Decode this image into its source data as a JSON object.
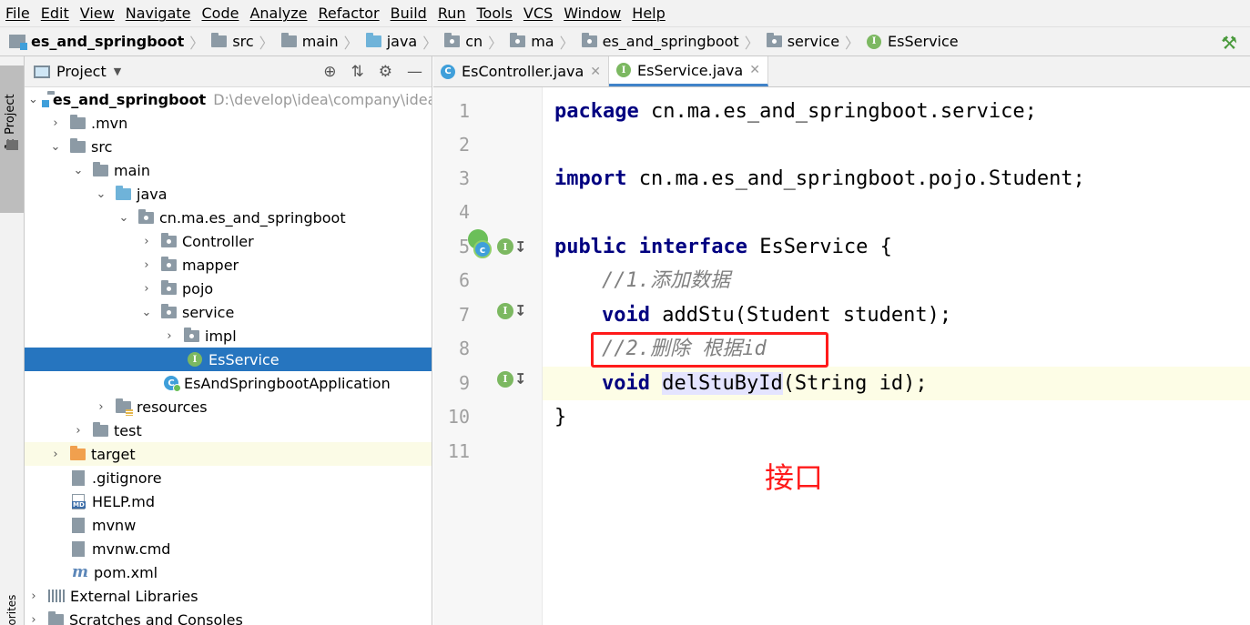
{
  "menu": [
    "File",
    "Edit",
    "View",
    "Navigate",
    "Code",
    "Analyze",
    "Refactor",
    "Build",
    "Run",
    "Tools",
    "VCS",
    "Window",
    "Help"
  ],
  "breadcrumb": {
    "items": [
      "es_and_springboot",
      "src",
      "main",
      "java",
      "cn",
      "ma",
      "es_and_springboot",
      "service",
      "EsService"
    ],
    "build_icon": "hammer-icon"
  },
  "tool_strip": {
    "project_label": "1: Project",
    "favorites_label": "avorites"
  },
  "project_panel": {
    "title": "Project",
    "tree": [
      {
        "label": "es_and_springboot",
        "path": "D:\\develop\\idea\\company\\idea_tj"
      },
      {
        "label": ".mvn"
      },
      {
        "label": "src"
      },
      {
        "label": "main"
      },
      {
        "label": "java"
      },
      {
        "label": "cn.ma.es_and_springboot"
      },
      {
        "label": "Controller"
      },
      {
        "label": "mapper"
      },
      {
        "label": "pojo"
      },
      {
        "label": "service"
      },
      {
        "label": "impl"
      },
      {
        "label": "EsService"
      },
      {
        "label": "EsAndSpringbootApplication"
      },
      {
        "label": "resources"
      },
      {
        "label": "test"
      },
      {
        "label": "target"
      },
      {
        "label": ".gitignore"
      },
      {
        "label": "HELP.md"
      },
      {
        "label": "mvnw"
      },
      {
        "label": "mvnw.cmd"
      },
      {
        "label": "pom.xml"
      },
      {
        "label": "External Libraries"
      },
      {
        "label": "Scratches and Consoles"
      }
    ]
  },
  "tabs": [
    {
      "label": "EsController.java",
      "icon": "C"
    },
    {
      "label": "EsService.java",
      "icon": "I"
    }
  ],
  "editor": {
    "line_numbers": [
      "1",
      "2",
      "3",
      "4",
      "5",
      "6",
      "7",
      "8",
      "9",
      "10",
      "11"
    ],
    "code": {
      "l1_kw": "package",
      "l1_rest": " cn.ma.es_and_springboot.service;",
      "l3_kw": "import",
      "l3_rest": " cn.ma.es_and_springboot.pojo.Student;",
      "l5_kw1": "public",
      "l5_kw2": "interface",
      "l5_rest": " EsService {",
      "l6_comment": "//1.添加数据",
      "l7_kw": "void",
      "l7_rest": " addStu(Student student);",
      "l8_comment": "//2.删除 根据id",
      "l9_kw": "void",
      "l9_method": "delStuById",
      "l9_rest": "(String id);",
      "l10": "}"
    }
  },
  "annotation": {
    "label": "接口",
    "color": "#ff1a1a"
  }
}
